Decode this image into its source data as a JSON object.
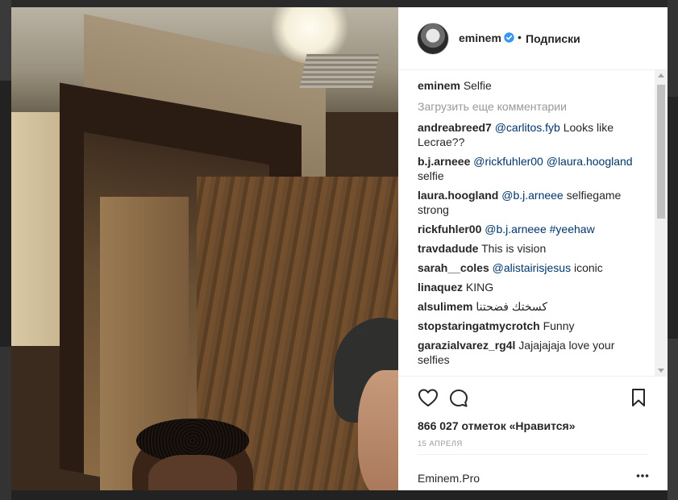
{
  "post": {
    "username": "eminem",
    "follow_status": "Подписки",
    "separator": "•",
    "caption_user": "eminem",
    "caption_text": "Selfie",
    "load_more": "Загрузить еще комментарии",
    "likes": "866 027 отметок «Нравится»",
    "date": "15 АПРЕЛЯ",
    "footer_text": "Eminem.Pro"
  },
  "comments": [
    {
      "user": "andreabreed7",
      "parts": [
        {
          "mention": "@carlitos.fyb"
        },
        {
          "text": " Looks like Lecrae??"
        }
      ]
    },
    {
      "user": "b.j.arneee",
      "parts": [
        {
          "mention": "@rickfuhler00"
        },
        {
          "text": " "
        },
        {
          "mention": "@laura.hoogland"
        },
        {
          "text": " selfie"
        }
      ]
    },
    {
      "user": "laura.hoogland",
      "parts": [
        {
          "mention": "@b.j.arneee"
        },
        {
          "text": " selfiegame strong"
        }
      ]
    },
    {
      "user": "rickfuhler00",
      "parts": [
        {
          "mention": "@b.j.arneee"
        },
        {
          "text": " "
        },
        {
          "mention": "#yeehaw"
        }
      ]
    },
    {
      "user": "travdadude",
      "parts": [
        {
          "text": "This is vision"
        }
      ]
    },
    {
      "user": "sarah__coles",
      "parts": [
        {
          "mention": "@alistairisjesus"
        },
        {
          "text": " iconic"
        }
      ]
    },
    {
      "user": "linaquez",
      "parts": [
        {
          "text": "KING"
        }
      ]
    },
    {
      "user": "alsulimem",
      "parts": [
        {
          "text": "كسختك فضحتنا"
        }
      ]
    },
    {
      "user": "stopstaringatmycrotch",
      "parts": [
        {
          "text": "Funny"
        }
      ]
    },
    {
      "user": "garazialvarez_rg4l",
      "parts": [
        {
          "text": "Jajajajaja love your selfies"
        }
      ]
    }
  ],
  "colors": {
    "text": "#262626",
    "mention": "#003569",
    "muted": "#999999",
    "verified": "#3897f0"
  },
  "icons": {
    "like": "heart-icon",
    "comment": "comment-icon",
    "save": "bookmark-icon",
    "options": "more-icon",
    "verified": "verified-badge-icon"
  }
}
